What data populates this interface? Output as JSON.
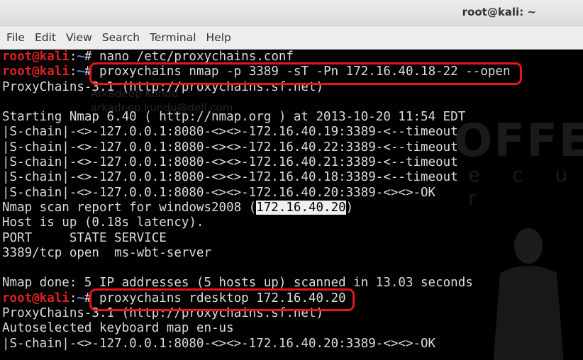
{
  "window": {
    "title": "root@kali: ~"
  },
  "menu": [
    "File",
    "Edit",
    "View",
    "Search",
    "Terminal",
    "Help"
  ],
  "prompt": {
    "user": "root@kali",
    "sep": ":",
    "path": "~",
    "symbol": "# "
  },
  "terminal": {
    "cmd1": "nano /etc/proxychains.conf",
    "cmd2": "proxychains nmap -p 3389 -sT -Pn 172.16.40.18-22 --open",
    "out1": "ProxyChains-3.1 (http://proxychains.sf.net)",
    "blank": "",
    "out2": "Starting Nmap 6.40 ( http://nmap.org ) at 2013-10-20 11:54 EDT",
    "chain1": "|S-chain|-<>-127.0.0.1:8080-<><>-172.16.40.19:3389-<--timeout",
    "chain2": "|S-chain|-<>-127.0.0.1:8080-<><>-172.16.40.22:3389-<--timeout",
    "chain3": "|S-chain|-<>-127.0.0.1:8080-<><>-172.16.40.21:3389-<--timeout",
    "chain4": "|S-chain|-<>-127.0.0.1:8080-<><>-172.16.40.18:3389-<--timeout",
    "chain5": "|S-chain|-<>-127.0.0.1:8080-<><>-172.16.40.20:3389-<><>-OK",
    "report_prefix": "Nmap scan report for windows2008 (",
    "report_ip": "172.16.40.20",
    "report_suffix": ")",
    "hostup": "Host is up (0.18s latency).",
    "port_header": "PORT     STATE SERVICE",
    "port_row": "3389/tcp open  ms-wbt-server",
    "done": "Nmap done: 5 IP addresses (5 hosts up) scanned in 13.03 seconds",
    "cmd3": "proxychains rdesktop 172.16.40.20",
    "out3": "ProxyChains-3.1 (http://proxychains.sf.net)",
    "out4": "Autoselected keyboard map en-us",
    "chain6": "|S-chain|-<>-127.0.0.1:8080-<><>-172.16.40.20:3389-<><>-OK"
  },
  "watermark": {
    "name_line1": "Arkadeep Kundu",
    "name_line2": "arkadeep.kundu@dell.com",
    "brand": "OFFENS",
    "brand_sub": "e c u r"
  },
  "colors": {
    "prompt_user": "#e02020",
    "prompt_path": "#5b7fff",
    "highlight_box": "#e8161b"
  }
}
